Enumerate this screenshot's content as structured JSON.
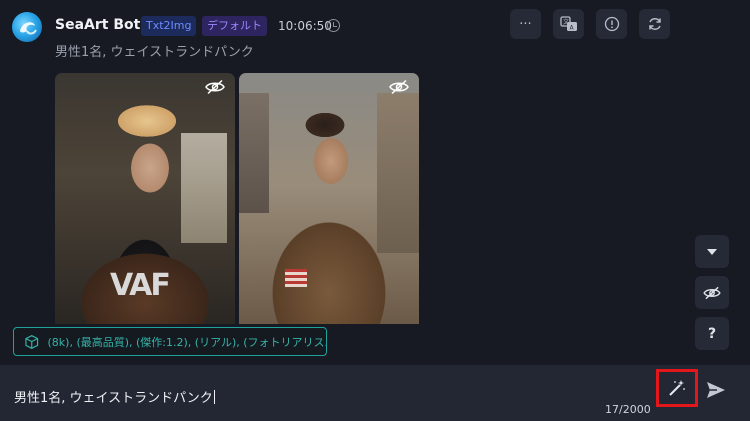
{
  "bot": {
    "name": "SeaArt Bot",
    "model_badge": "Txt2Img",
    "style_badge": "デフォルト",
    "time": "10:06:50",
    "prompt_line": "男性1名, ウェイストランドパンク"
  },
  "header_actions": {
    "more_label": "···",
    "translate_icon": "translate-icon",
    "info_icon": "info-icon",
    "refresh_icon": "refresh-icon"
  },
  "images": [
    {
      "icon": "eye-off-icon",
      "logo_text": "VAF"
    },
    {
      "icon": "eye-off-icon"
    }
  ],
  "side_actions": {
    "scroll_down_icon": "chevron-down-icon",
    "hide_icon": "eye-off-icon",
    "help_label": "?"
  },
  "prompt_chip": {
    "icon": "cube-icon",
    "text": "(8k), (最高品質), (傑作:1.2), (リアル), (フォトリアリス..."
  },
  "composer": {
    "input_value": "男性1名, ウェイストランドパンク",
    "counter": "17/2000",
    "magic_icon": "magic-wand-icon",
    "send_icon": "send-icon"
  },
  "colors": {
    "background": "#171a23",
    "input_bar": "#232734",
    "accent_teal": "#1fa29a",
    "highlight_red": "#e3161b",
    "badge_blue": "#6b8cff",
    "badge_purple": "#9d86ff"
  }
}
